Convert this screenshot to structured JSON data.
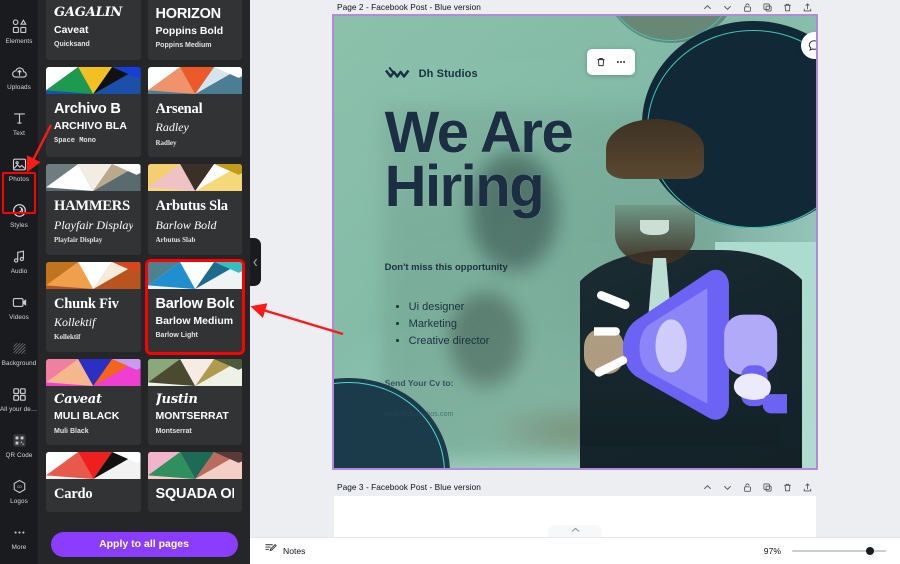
{
  "rail": {
    "items": [
      {
        "label": "Elements",
        "icon": "shapes-icon"
      },
      {
        "label": "Uploads",
        "icon": "upload-cloud-icon"
      },
      {
        "label": "Text",
        "icon": "text-t-icon"
      },
      {
        "label": "Photos",
        "icon": "photo-icon"
      },
      {
        "label": "Styles",
        "icon": "palette-icon"
      },
      {
        "label": "Audio",
        "icon": "music-note-icon"
      },
      {
        "label": "Videos",
        "icon": "video-icon"
      },
      {
        "label": "Background",
        "icon": "background-hatch-icon"
      },
      {
        "label": "All your desi…",
        "icon": "grid-squares-icon"
      },
      {
        "label": "QR Code",
        "icon": "qr-code-icon"
      },
      {
        "label": "Logos",
        "icon": "logo-hex-icon"
      },
      {
        "label": "More",
        "icon": "ellipsis-icon"
      }
    ],
    "selected": "Styles"
  },
  "annotations": {
    "styles_arrow": "red-arrow-pointing-to-styles",
    "card_arrow": "red-arrow-pointing-to-selected-style",
    "highlight_color": "#ff0000"
  },
  "style_panel": {
    "apply_label": "Apply to all pages",
    "selected_index": 7,
    "cards": [
      {
        "l1": "GAGALIN",
        "l2": "Caveat",
        "l3": "Quicksand",
        "style": "f-script",
        "swatch": [
          "#101b33",
          "#ef4931",
          "#c8d820",
          "#ffffff",
          "#1440d8",
          "#f6d344"
        ]
      },
      {
        "l1": "HORIZON",
        "l2": "Poppins Bold",
        "l3": "Poppins Medium",
        "style": "",
        "swatch": [
          "#d7d95e",
          "#4aa886",
          "#b99fe0",
          "#ffffff",
          "#e8b3c3",
          "#3a6ca8"
        ]
      },
      {
        "l1": "Archivo B",
        "l2": "ARCHIVO BLA",
        "l3": "Space  Mono",
        "style": "f-mono",
        "swatch": [
          "#ffffff",
          "#1c9a50",
          "#f2c021",
          "#111111",
          "#1440d8",
          "#1b4fa8"
        ]
      },
      {
        "l1": "Arsenal",
        "l2": "Radley",
        "l3": "Radley",
        "style": "f-serif",
        "swatch": [
          "#ffffff",
          "#f0936b",
          "#ec5a29",
          "#d6e5ec",
          "#ffffff",
          "#4b7d94"
        ]
      },
      {
        "l1": "HAMMERS",
        "l2": "Playfair Display",
        "l3": "Playfair Display",
        "style": "f-serif",
        "swatch": [
          "#6f7d80",
          "#ffffff",
          "#f2ece2",
          "#bba98d",
          "#ffffff",
          "#5a6b70"
        ]
      },
      {
        "l1": "Arbutus Sla",
        "l2": "Barlow Bold",
        "l3": "Arbutus Slab",
        "style": "f-serif",
        "swatch": [
          "#f3cf70",
          "#efc3c6",
          "#3a3027",
          "#ffffff",
          "#c49a1a",
          "#f5d87a"
        ]
      },
      {
        "l1": "Chunk Fiv",
        "l2": "Kollektif",
        "l3": "Kollektif",
        "style": "f-serif",
        "swatch": [
          "#c1741e",
          "#f0a04b",
          "#ffffff",
          "#f7ecd9",
          "#d4471f",
          "#b9551c"
        ]
      },
      {
        "l1": "Barlow Bold",
        "l2": "Barlow Medium",
        "l3": "Barlow Light",
        "style": "",
        "swatch": [
          "#4e8190",
          "#1f8fd0",
          "#ffffff",
          "#1e6c8c",
          "#35bfc0",
          "#eef3f4"
        ]
      },
      {
        "l1": "Caveat",
        "l2": "MULI BLACK",
        "l3": "Muli Black",
        "style": "f-script",
        "swatch": [
          "#f0809f",
          "#f5b78c",
          "#2b2fc4",
          "#f4651c",
          "#c79cf0",
          "#ef3fd1"
        ]
      },
      {
        "l1": "Justin",
        "l2": "MONTSERRAT",
        "l3": "Montserrat",
        "style": "f-script",
        "swatch": [
          "#8aa87a",
          "#4a4a30",
          "#f7ece4",
          "#b09a4e",
          "#4d5a3c",
          "#eef1e6"
        ]
      },
      {
        "l1": "Cardo",
        "l2": "",
        "l3": "",
        "style": "f-serif",
        "swatch": [
          "#ffffff",
          "#e8584b",
          "#ee1f1f",
          "#111111",
          "#ffffff",
          "#f2f2f2"
        ]
      },
      {
        "l1": "SQUADA ONE",
        "l2": "",
        "l3": "",
        "style": "f-cond",
        "swatch": [
          "#f0b4cb",
          "#2f8f5e",
          "#1d6b56",
          "#b96d5f",
          "#5a3a36",
          "#f3cfc6"
        ]
      }
    ]
  },
  "editor": {
    "pages": [
      {
        "title": "Page 2 - Facebook Post - Blue version",
        "state": "active"
      },
      {
        "title": "Page 3 - Facebook Post - Blue version",
        "state": "empty"
      }
    ],
    "page_tools": [
      "move-up-icon",
      "move-down-icon",
      "lock-icon",
      "duplicate-icon",
      "delete-icon",
      "export-icon"
    ],
    "element_toolbar": [
      "trash-icon",
      "more-options-icon"
    ],
    "comment_fab": "comment-bubble-icon"
  },
  "poster": {
    "logo_text": "Dh Studios",
    "headline_line1": "We Are",
    "headline_line2": "Hiring",
    "subtitle": "Don't miss this opportunity",
    "bullets": [
      "Ui designer",
      "Marketing",
      "Creative director"
    ],
    "cta": "Send Your Cv to:",
    "email": "hello@dhstudios.com",
    "colors": {
      "headline": "#1b2e42",
      "dark_circle": "#142c3c",
      "accent_ring": "#4fd6d0",
      "megaphone": "#6c63f5",
      "background": "#a9d2c0"
    }
  },
  "bottombar": {
    "notes_label": "Notes",
    "notes_icon": "notes-icon",
    "zoom_value": "97%"
  }
}
